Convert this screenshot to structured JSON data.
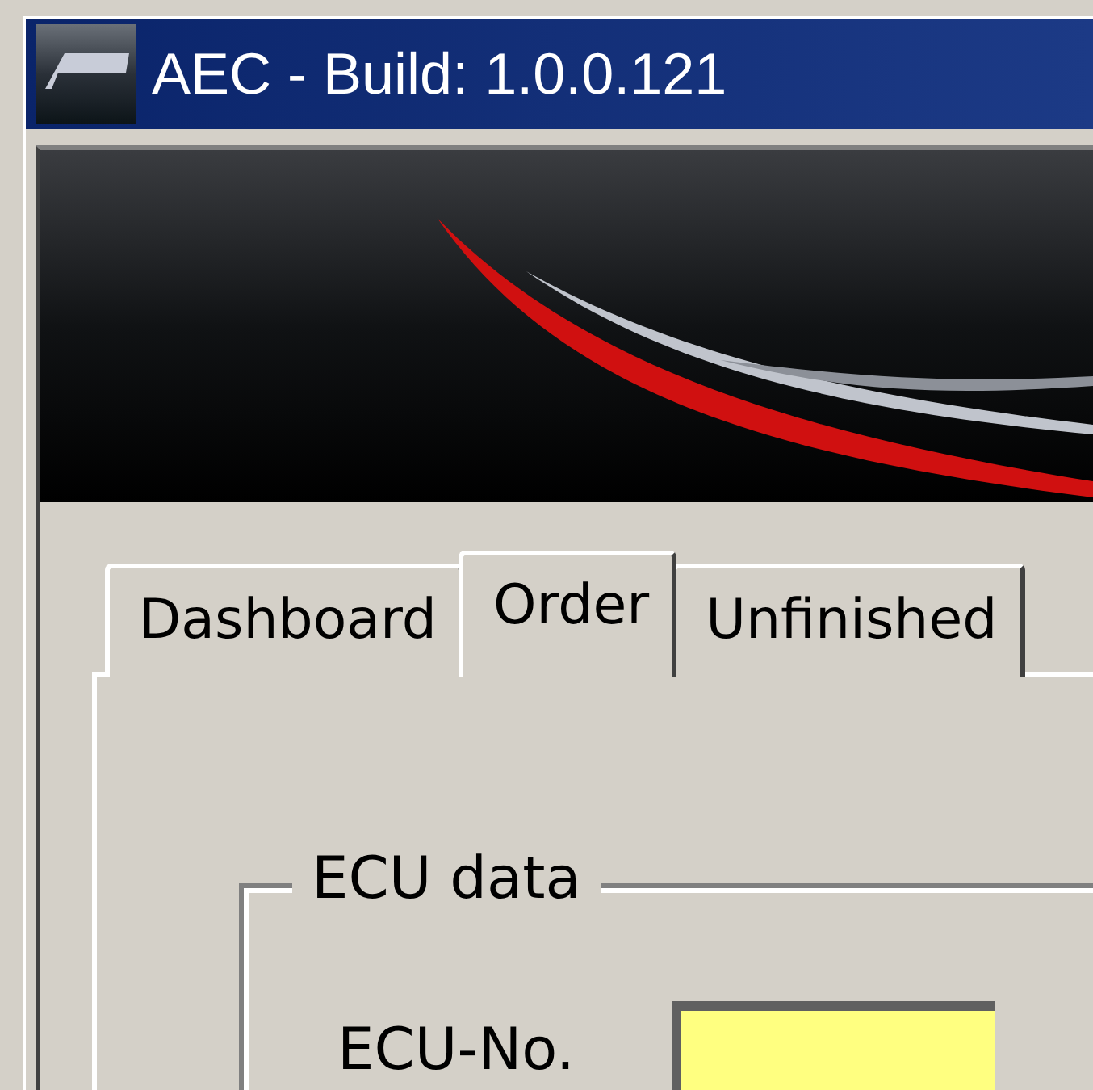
{
  "window": {
    "title": "AEC - Build: 1.0.0.121"
  },
  "tabs": [
    {
      "label": "Dashboard",
      "selected": false
    },
    {
      "label": "Order",
      "selected": true
    },
    {
      "label": "Unfinished",
      "selected": false
    }
  ],
  "group": {
    "title": "ECU data",
    "fields": [
      {
        "label": "ECU-No."
      }
    ]
  }
}
